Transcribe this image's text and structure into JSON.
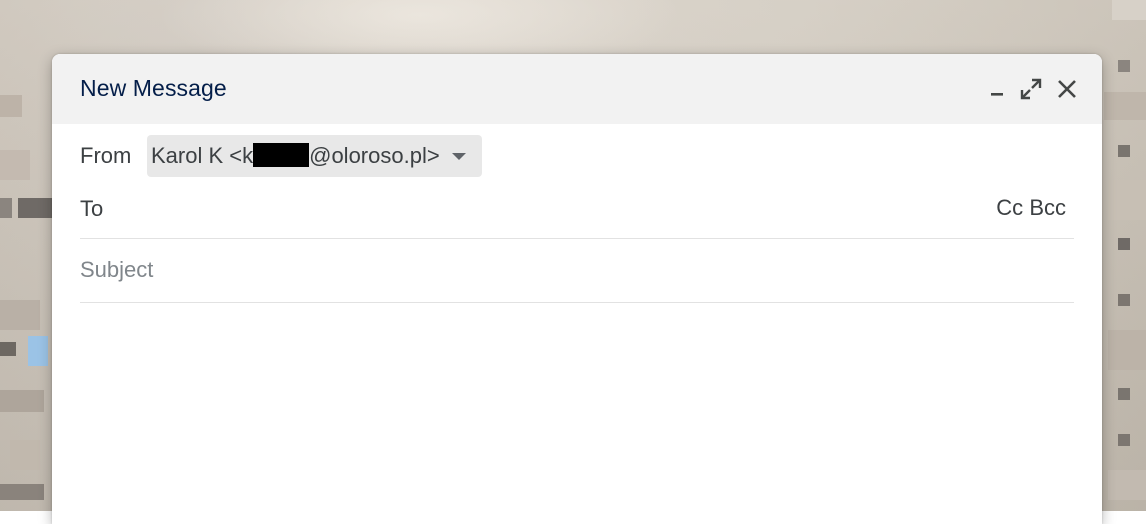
{
  "compose": {
    "title": "New Message",
    "from_label": "From",
    "from_name_prefix": "Karol K <k",
    "from_email_suffix": "@oloroso.pl>",
    "to_label": "To",
    "cc_label": "Cc",
    "bcc_label": "Bcc",
    "subject_placeholder": "Subject",
    "body_value": ""
  },
  "icons": {
    "minimize": "minimize-icon",
    "expand": "expand-icon",
    "close": "close-icon",
    "dropdown": "caret-down-icon"
  },
  "colors": {
    "title": "#041e49",
    "header_bg": "#f2f2f2",
    "from_chip_bg": "#e8e8e8"
  }
}
